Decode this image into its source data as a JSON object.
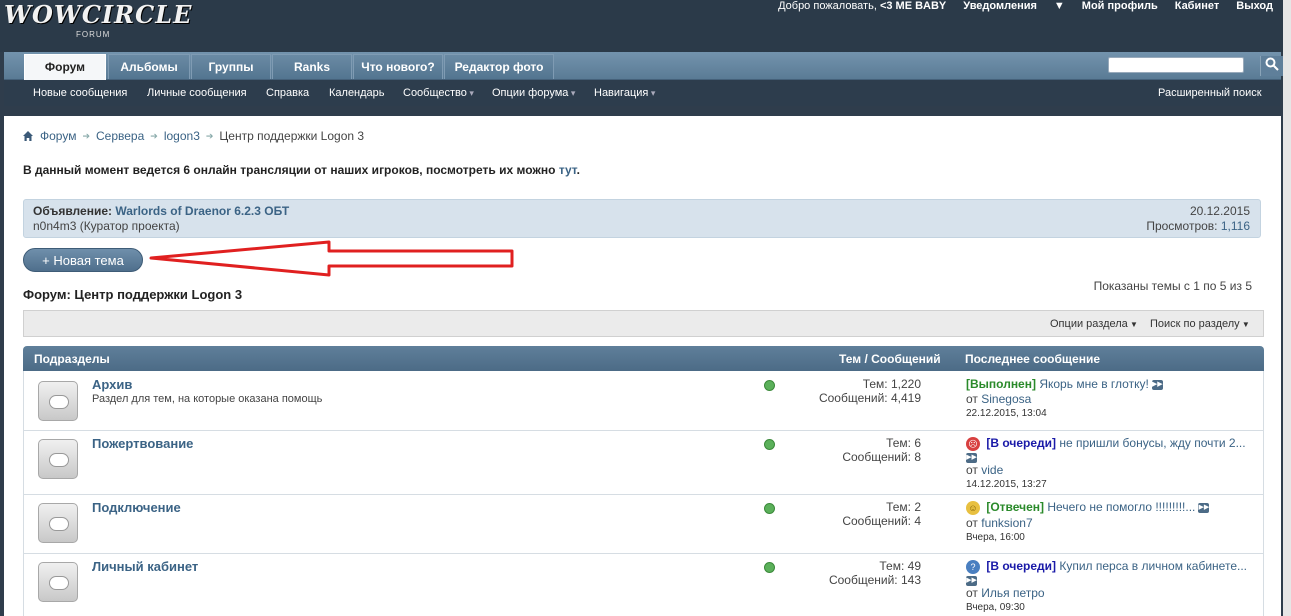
{
  "header": {
    "logo": "WOWCIRCLE",
    "logo_sub": "FORUM",
    "welcome_prefix": "Добро пожаловать,",
    "username": "<3 ME BABY",
    "notifications": "Уведомления",
    "profile": "Мой профиль",
    "cabinet": "Кабинет",
    "logout": "Выход"
  },
  "nav": {
    "tabs": [
      "Форум",
      "Альбомы",
      "Группы",
      "Ranks",
      "Что нового?",
      "Редактор фото"
    ],
    "subnav": [
      "Новые сообщения",
      "Личные сообщения",
      "Справка",
      "Календарь",
      "Сообщество",
      "Опции форума",
      "Навигация"
    ],
    "advanced_search": "Расширенный поиск"
  },
  "breadcrumb": [
    "Форум",
    "Сервера",
    "logon3",
    "Центр поддержки Logon 3"
  ],
  "notice": {
    "text": "В данный момент ведется 6 онлайн трансляции от наших игроков, посмотреть их можно",
    "link": "тут",
    "end": "."
  },
  "announcement": {
    "label": "Объявление:",
    "title": "Warlords of Draenor 6.2.3 ОБТ",
    "author": "n0n4m3 (Куратор проекта)",
    "date": "20.12.2015",
    "views_label": "Просмотров:",
    "views": "1,116"
  },
  "new_thread_button": "+ Новая тема",
  "shown_threads": "Показаны темы с 1 по 5 из 5",
  "forum_title": "Форум: Центр поддержки Logon 3",
  "options": {
    "section_options": "Опции раздела",
    "section_search": "Поиск по разделу"
  },
  "table": {
    "col_subforums": "Подразделы",
    "col_threads": "Тем / Сообщений",
    "col_last": "Последнее сообщение",
    "rows": [
      {
        "name": "Архив",
        "desc": "Раздел для тем, на которые оказана помощь",
        "threads": "Тем: 1,220",
        "posts": "Сообщений: 4,419",
        "tag": "[Выполнен]",
        "title": "Якорь мне в глотку!",
        "by_label": "от",
        "by": "Sinegosa",
        "date": "22.12.2015, 13:04"
      },
      {
        "name": "Пожертвование",
        "desc": "",
        "threads": "Тем: 6",
        "posts": "Сообщений: 8",
        "tag": "[В очереди]",
        "title": "не пришли бонусы, жду почти 2...",
        "by_label": "от",
        "by": "vide",
        "date": "14.12.2015, 13:27"
      },
      {
        "name": "Подключение",
        "desc": "",
        "threads": "Тем: 2",
        "posts": "Сообщений: 4",
        "tag": "[Отвечен]",
        "title": "Нечего не помогло !!!!!!!!!...",
        "by_label": "от",
        "by": "funksion7",
        "date": "Вчера, 16:00"
      },
      {
        "name": "Личный кабинет",
        "desc": "",
        "threads": "Тем: 49",
        "posts": "Сообщений: 143",
        "tag": "[В очереди]",
        "title": "Купил перса в личном кабинете...",
        "by_label": "от",
        "by": "Илья петро",
        "date": "Вчера, 09:30"
      }
    ]
  }
}
